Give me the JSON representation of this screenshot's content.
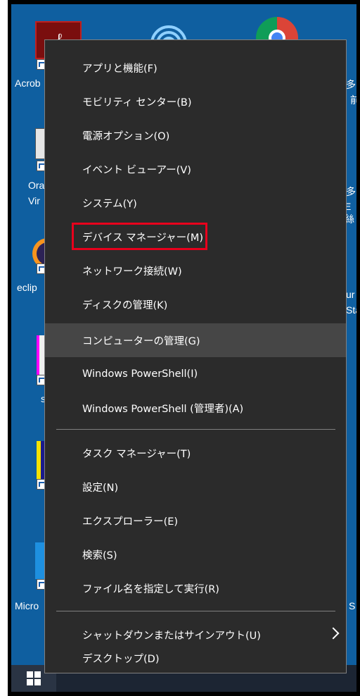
{
  "desktop": {
    "labels": {
      "acrobat": "Acrob",
      "ora": "Ora",
      "vir": "Vir",
      "eclipse": "eclip",
      "s": "s",
      "micro": "Micro",
      "right1": "多",
      "right2": "前",
      "right3": "多",
      "right4": "E絲",
      "right5": "ur",
      "right6": "Sta",
      "right7": "S"
    }
  },
  "menu": {
    "items": [
      {
        "label": "アプリと機能(F)"
      },
      {
        "label": "モビリティ センター(B)"
      },
      {
        "label": "電源オプション(O)"
      },
      {
        "label": "イベント ビューアー(V)"
      },
      {
        "label": "システム(Y)"
      },
      {
        "label": "デバイス マネージャー(M)"
      },
      {
        "label": "ネットワーク接続(W)"
      },
      {
        "label": "ディスクの管理(K)"
      },
      {
        "label": "コンピューターの管理(G)"
      },
      {
        "label": "Windows PowerShell(I)"
      },
      {
        "label": "Windows PowerShell (管理者)(A)"
      },
      {
        "label": "タスク マネージャー(T)"
      },
      {
        "label": "設定(N)"
      },
      {
        "label": "エクスプローラー(E)"
      },
      {
        "label": "検索(S)"
      },
      {
        "label": "ファイル名を指定して実行(R)"
      },
      {
        "label": "シャットダウンまたはサインアウト(U)"
      },
      {
        "label": "デスクトップ(D)"
      }
    ],
    "hovered_index": 8,
    "highlighted_index": 5
  },
  "colors": {
    "menu_bg": "#2b2b2b",
    "hover_bg": "#464646",
    "highlight_border": "#e8001c",
    "desktop_bg": "#0f5fa0",
    "taskbar_bg": "#1c2533"
  }
}
